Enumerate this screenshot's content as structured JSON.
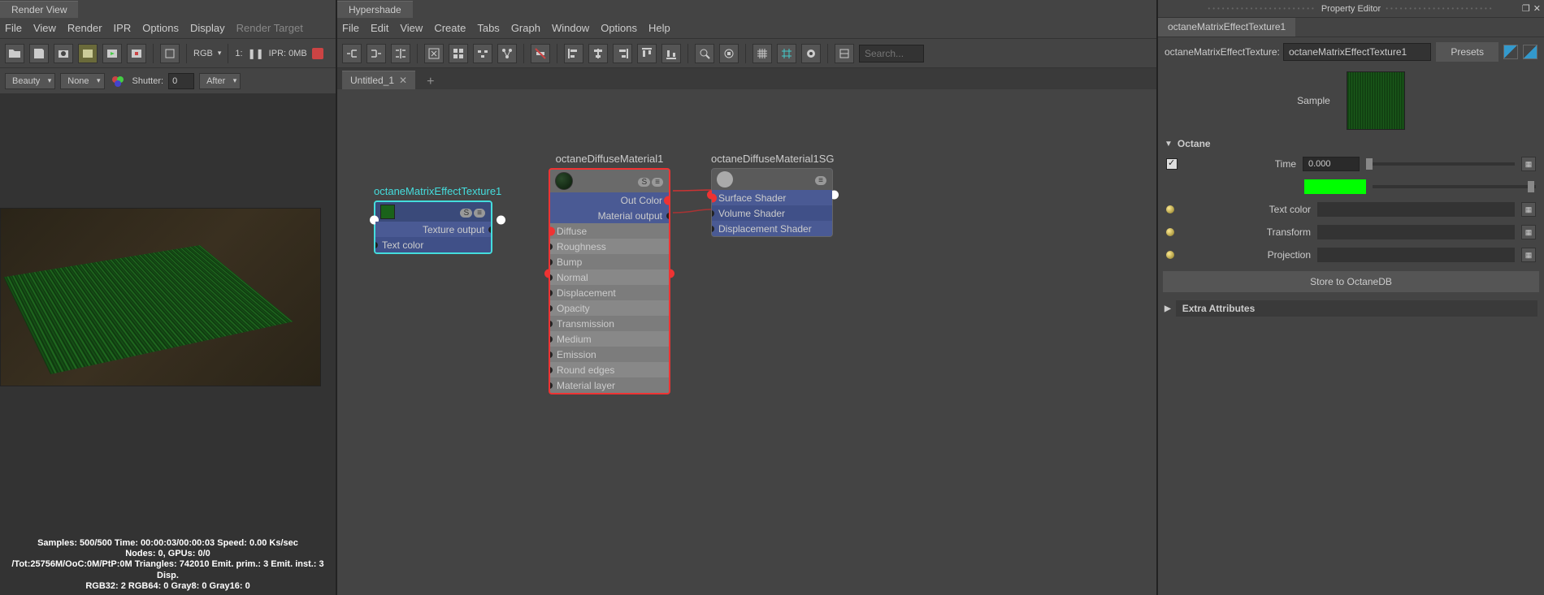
{
  "render_view": {
    "title": "Render View",
    "menu": [
      "File",
      "View",
      "Render",
      "IPR",
      "Options",
      "Display",
      "Render Target"
    ],
    "rgb_label": "RGB",
    "frame_label": "1:",
    "ipr_label": "IPR: 0MB",
    "dropdown1": "Beauty",
    "dropdown2": "None",
    "shutter_label": "Shutter:",
    "shutter_value": "0",
    "after_label": "After",
    "stats": {
      "line1": "Samples: 500/500 Time: 00:00:03/00:00:03 Speed: 0.00 Ks/sec",
      "line2": "Nodes: 0, GPUs: 0/0",
      "line3": "/Tot:25756M/OoC:0M/PtP:0M Triangles: 742010 Emit. prim.: 3 Emit. inst.: 3 Disp.",
      "line4": "RGB32: 2 RGB64: 0 Gray8: 0 Gray16: 0"
    }
  },
  "hypershade": {
    "title": "Hypershade",
    "menu": [
      "File",
      "Edit",
      "View",
      "Create",
      "Tabs",
      "Graph",
      "Window",
      "Options",
      "Help"
    ],
    "search_placeholder": "Search...",
    "tab_name": "Untitled_1",
    "nodes": {
      "texture": {
        "title": "octaneMatrixEffectTexture1",
        "out1": "Texture output",
        "in1": "Text color"
      },
      "material": {
        "title": "octaneDiffuseMaterial1",
        "out1": "Out Color",
        "out2": "Material output",
        "ins": [
          "Diffuse",
          "Roughness",
          "Bump",
          "Normal",
          "Displacement",
          "Opacity",
          "Transmission",
          "Medium",
          "Emission",
          "Round edges",
          "Material layer"
        ]
      },
      "sg": {
        "title": "octaneDiffuseMaterial1SG",
        "ins": [
          "Surface Shader",
          "Volume Shader",
          "Displacement Shader"
        ]
      }
    }
  },
  "property_editor": {
    "title": "Property Editor",
    "tab": "octaneMatrixEffectTexture1",
    "field_label": "octaneMatrixEffectTexture:",
    "field_value": "octaneMatrixEffectTexture1",
    "presets_btn": "Presets",
    "sample_label": "Sample",
    "section1": "Octane",
    "time_label": "Time",
    "time_value": "0.000",
    "props": [
      "Text color",
      "Transform",
      "Projection"
    ],
    "store_btn": "Store to OctaneDB",
    "section2": "Extra Attributes"
  }
}
